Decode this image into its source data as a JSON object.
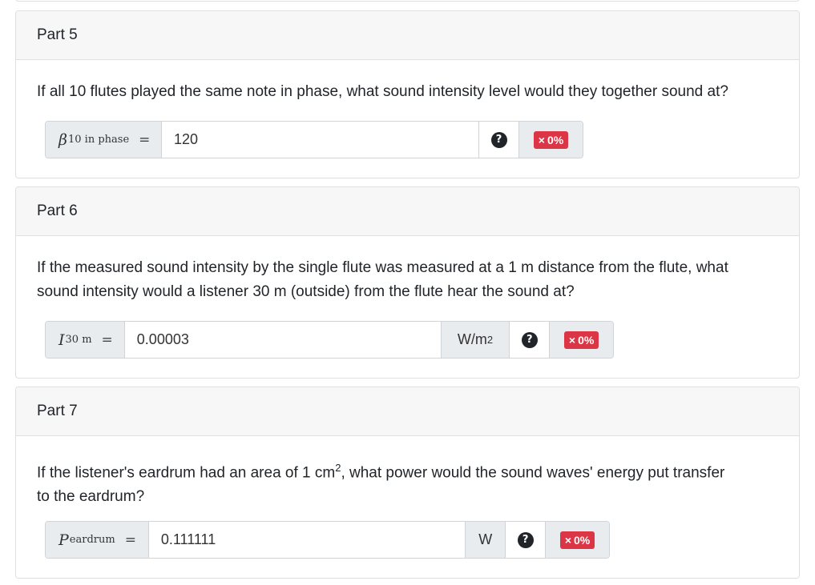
{
  "parts": [
    {
      "header": "Part 5",
      "question": "If all 10 flutes played the same note in phase, what sound intensity level would they together sound at?",
      "symbol": "β",
      "subscript": "10 in phase",
      "equals": "=",
      "value": "120",
      "unit": "",
      "help": "?",
      "score": "0%",
      "score_icon": "×"
    },
    {
      "header": "Part 6",
      "question_line1": "If the measured sound intensity by the single flute was measured at a 1 m distance from the flute, what",
      "question_line2": "sound intensity would a listener 30 m (outside) from the flute hear the sound at?",
      "symbol": "I",
      "subscript": "30 m",
      "equals": "=",
      "value": "0.00003",
      "unit": "W/m",
      "unit_sup": "2",
      "help": "?",
      "score": "0%",
      "score_icon": "×"
    },
    {
      "header": "Part 7",
      "question_line1_a": "If the listener's eardrum had an area of 1 cm",
      "question_line1_sup": "2",
      "question_line1_b": ", what power would the sound waves' energy put transfer",
      "question_line2": "to the eardrum?",
      "symbol": "P",
      "subscript": "eardrum",
      "equals": "=",
      "value": "0.111111",
      "unit": "W",
      "help": "?",
      "score": "0%",
      "score_icon": "×"
    }
  ],
  "colors": {
    "badge_incorrect": "#dc3545",
    "header_bg": "#f7f7f7",
    "addon_bg": "#e9ecef"
  }
}
